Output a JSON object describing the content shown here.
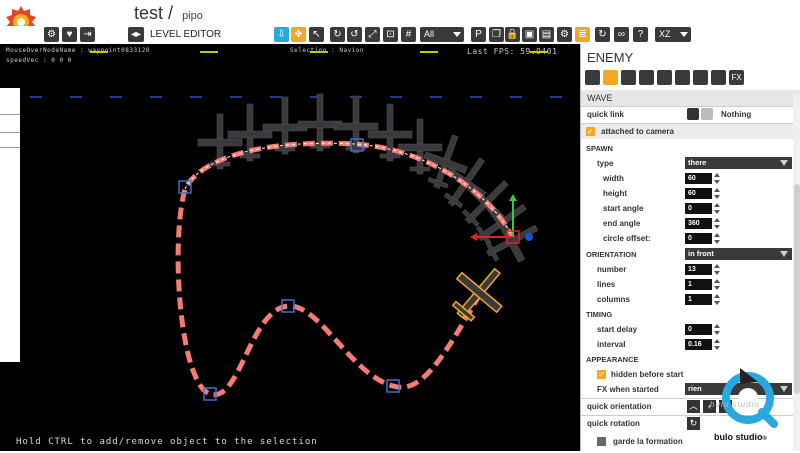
{
  "app": {
    "project": "test",
    "separator": "/",
    "scene": "pipo",
    "mode_label": "LEVEL EDITOR",
    "layer_select": "All",
    "axis_select": "XZ",
    "accent": "#f5a623",
    "highlight": "#29a8e0"
  },
  "viewport": {
    "mouse_over": "MouseOverNodeName : waypoint0833120",
    "selection": "Selection : Navion",
    "speed": "speedVec : 0 0 0",
    "fps": "Last FPS: 59.9401",
    "hint": "Hold CTRL to add/remove object to the selection",
    "path_color": "#f47c72",
    "waypoint_color": "#3a6fd8"
  },
  "panel": {
    "title": "ENEMY",
    "section": "WAVE",
    "quick_link_label": "quick link",
    "quick_link_value": "Nothing",
    "attached_label": "attached to camera",
    "spawn_header": "SPAWN",
    "type_label": "type",
    "type_value": "there",
    "width_label": "width",
    "width_value": "60",
    "height_label": "height",
    "height_value": "60",
    "start_angle_label": "start angle",
    "start_angle_value": "0",
    "end_angle_label": "end angle",
    "end_angle_value": "360",
    "circle_offset_label": "circle offset:",
    "circle_offset_value": "0",
    "orientation_header": "ORIENTATION",
    "orientation_value": "in front",
    "number_label": "number",
    "number_value": "13",
    "lines_label": "lines",
    "lines_value": "1",
    "columns_label": "columns",
    "columns_value": "1",
    "timing_header": "TIMING",
    "start_delay_label": "start delay",
    "start_delay_value": "0",
    "interval_label": "interval",
    "interval_value": "0.16",
    "appearance_header": "APPEARANCE",
    "hidden_label": "hidden before start",
    "fx_label": "FX when started",
    "fx_value": "rien",
    "quick_orientation_label": "quick orientation",
    "quick_rotation_label": "quick rotation",
    "garde_label": "garde la formation"
  },
  "watermark": {
    "brand": "bulo studio",
    "line2": "bulo studio",
    "trademark": "®"
  }
}
